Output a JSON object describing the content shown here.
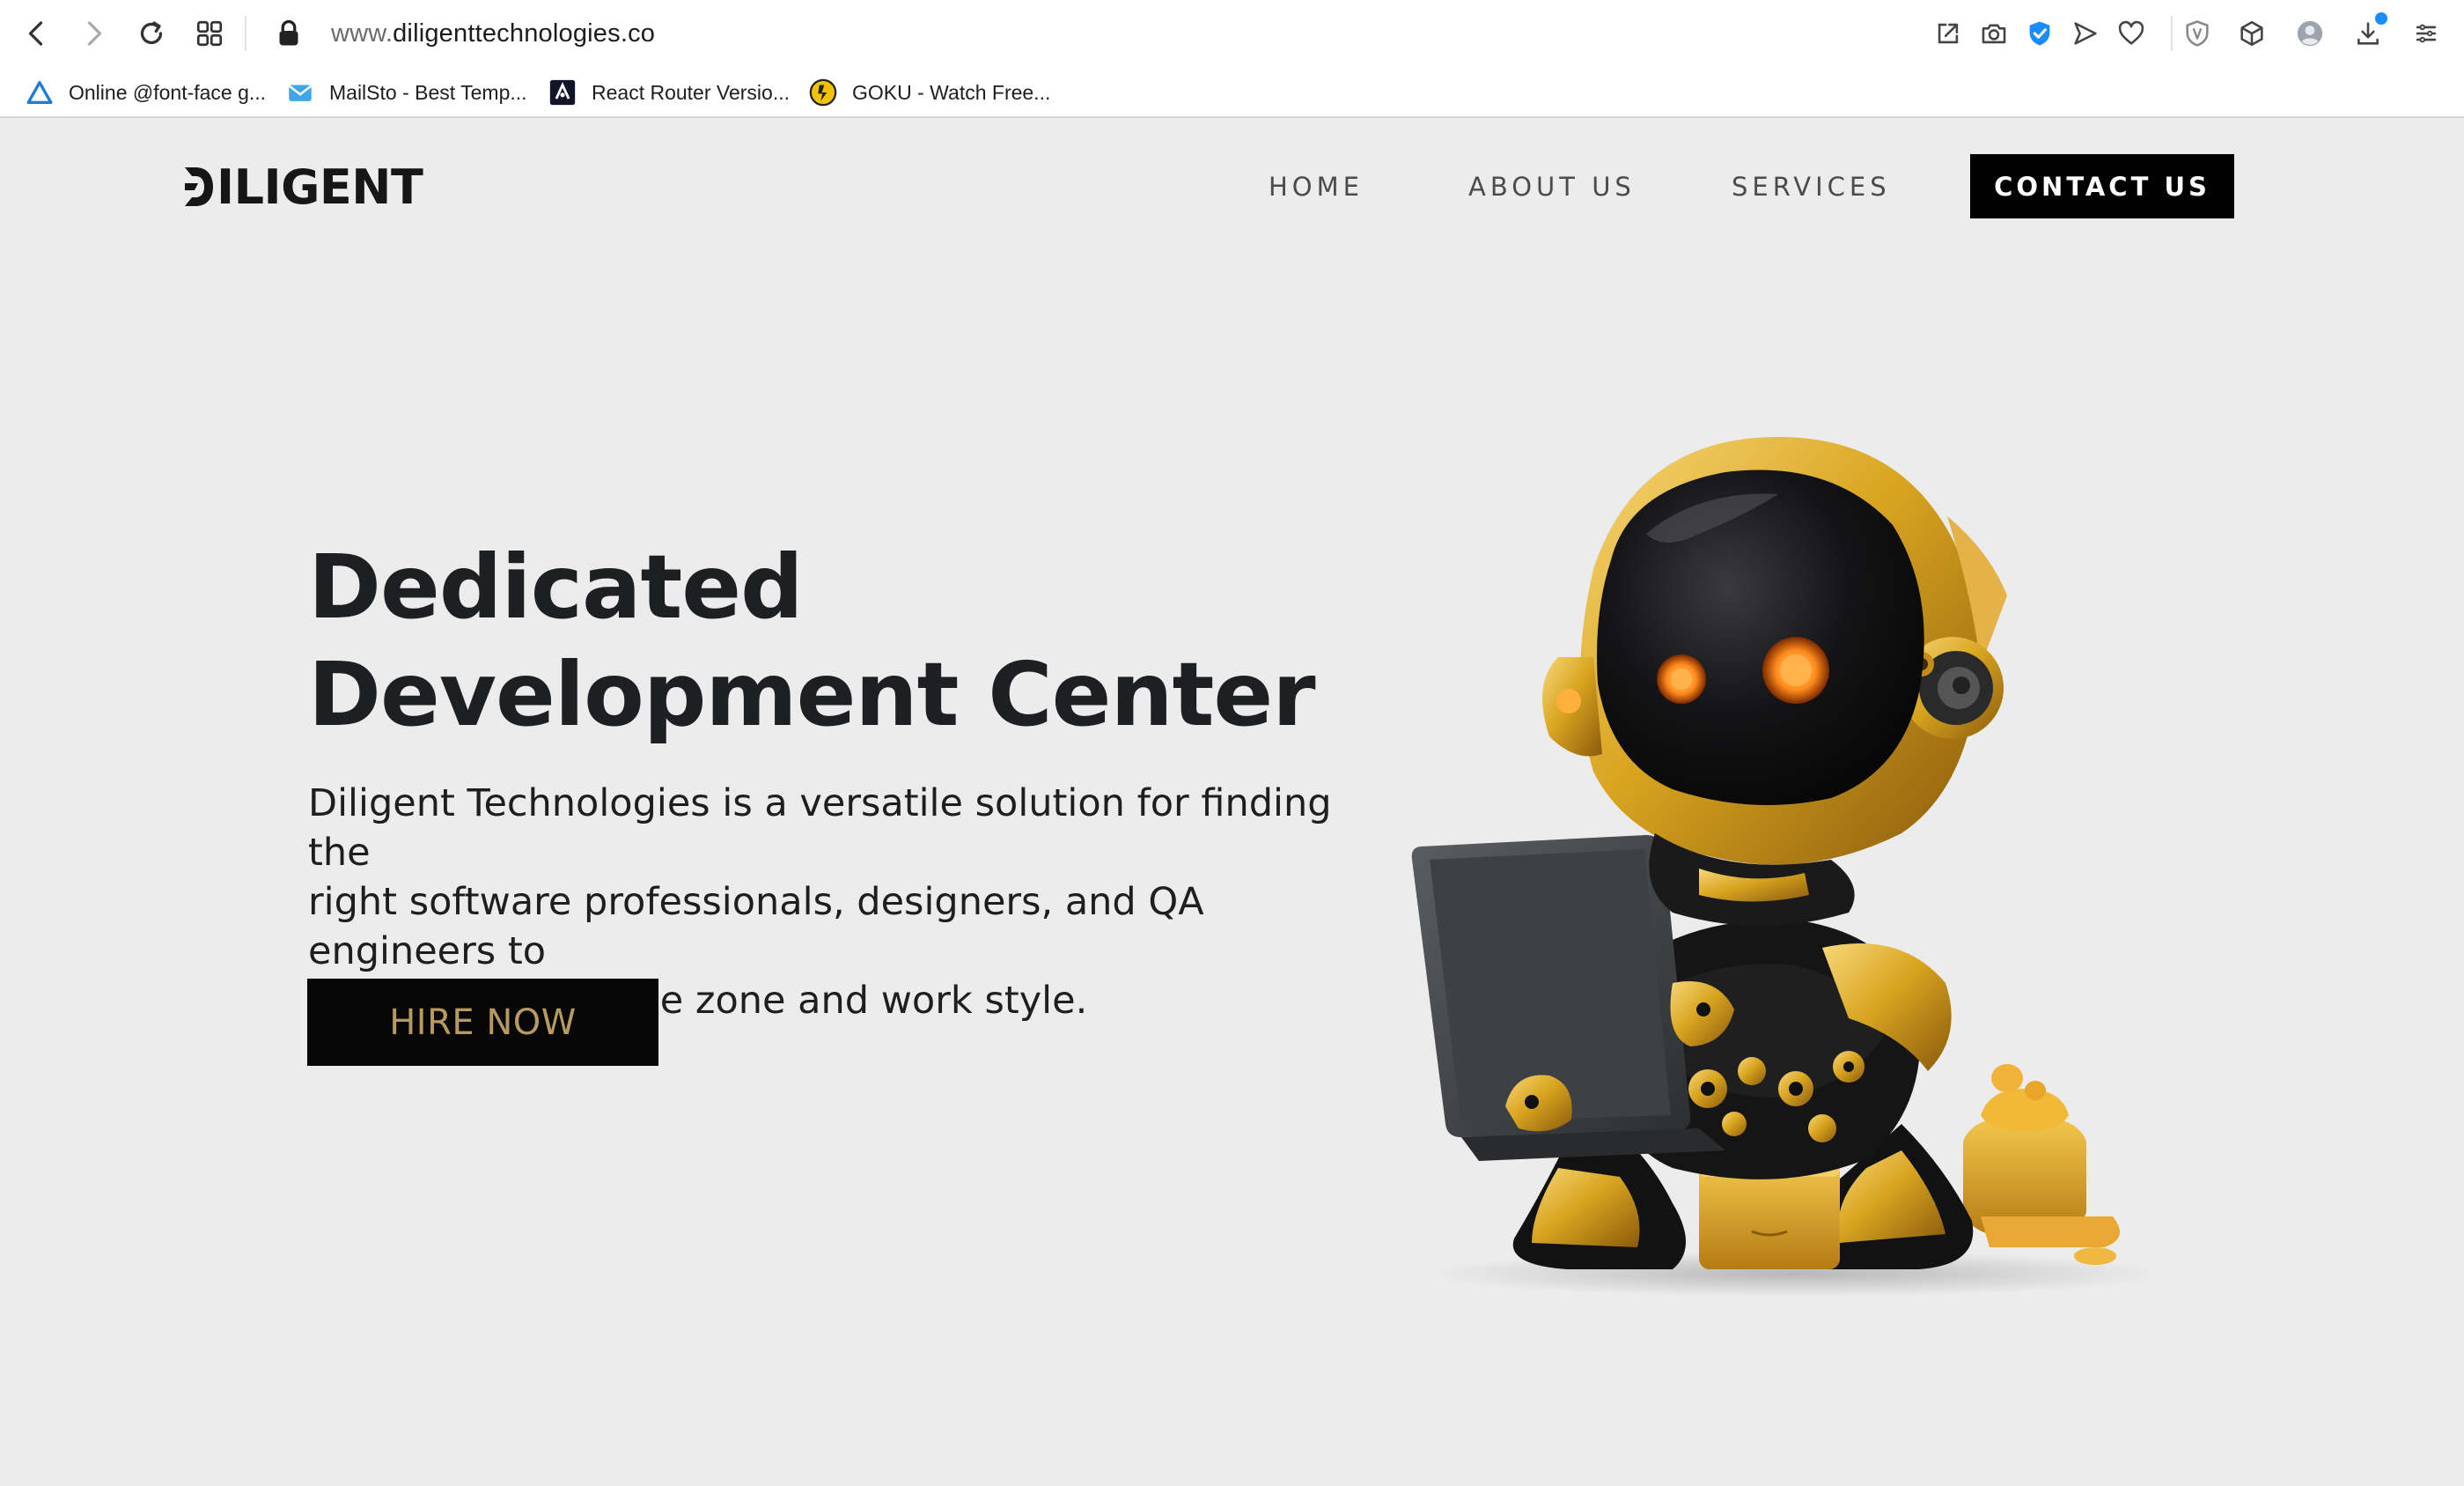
{
  "browser": {
    "url_prefix": "www.",
    "url_host": "diligenttechnologies.co",
    "icons": {
      "back": "chevron-left-icon",
      "forward": "chevron-right-icon",
      "reload": "reload-icon",
      "tabs": "grid-icon",
      "lock": "lock-icon"
    },
    "bookmarks": [
      {
        "label": "Online @font-face g...",
        "icon": "triangle-icon"
      },
      {
        "label": "MailSto - Best Temp...",
        "icon": "mail-icon"
      },
      {
        "label": "React Router Versio...",
        "icon": "react-router-icon"
      },
      {
        "label": "GOKU - Watch Free...",
        "icon": "goku-icon"
      }
    ],
    "accent_color": "#1a8cff"
  },
  "site": {
    "logo_text": "ILIGENT",
    "nav": [
      {
        "label": "HOME"
      },
      {
        "label": "ABOUT US"
      },
      {
        "label": "SERVICES"
      }
    ],
    "contact_label": "CONTACT US"
  },
  "hero": {
    "title_line1": "Dedicated",
    "title_line2": "Development Center",
    "desc_line1": "Diligent Technologies is a versatile solution for finding the",
    "desc_line2": "right software professionals, designers, and QA engineers to",
    "desc_line3": "fit your unique time zone and work style.",
    "cta_label": "HIRE NOW",
    "cta_text_color": "#b89a5e",
    "image": "robot-with-laptop-illustration"
  },
  "colors": {
    "page_bg": "#ececec",
    "gold": "#d9a520",
    "dark": "#070707"
  }
}
